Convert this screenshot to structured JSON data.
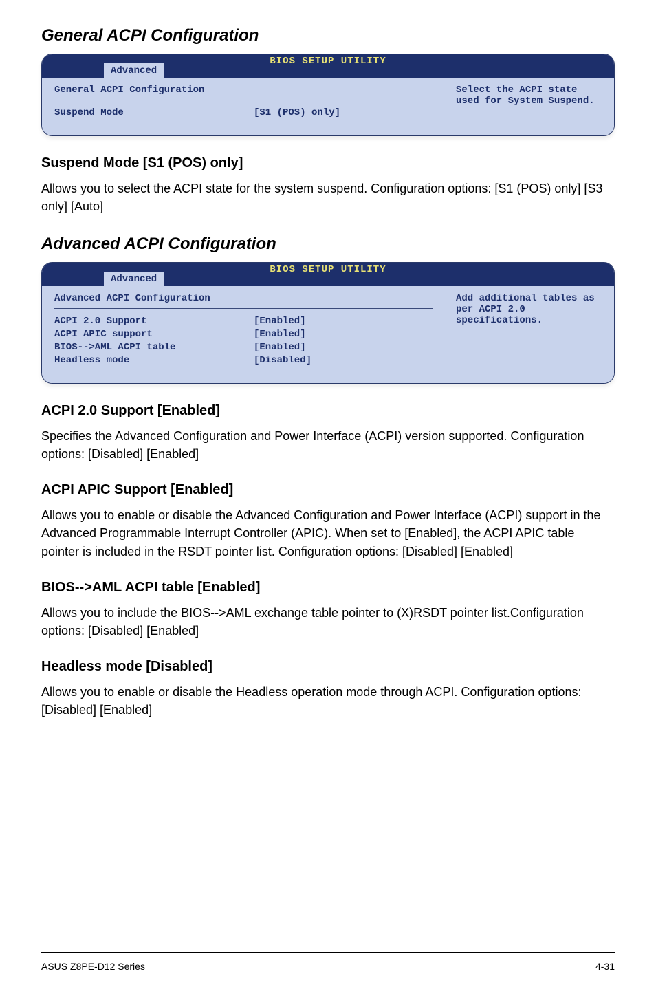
{
  "heading1": "General ACPI Configuration",
  "bios1": {
    "title": "BIOS SETUP UTILITY",
    "tab": "Advanced",
    "section": "General ACPI Configuration",
    "rows": [
      {
        "label": "Suspend Mode",
        "value": "[S1 (POS) only]"
      }
    ],
    "help": "Select the ACPI state used for System Suspend."
  },
  "sub1": "Suspend Mode [S1 (POS) only]",
  "body1": "Allows you to select the ACPI state for the system suspend. Configuration options: [S1 (POS) only] [S3 only] [Auto]",
  "heading2": "Advanced ACPI Configuration",
  "bios2": {
    "title": "BIOS SETUP UTILITY",
    "tab": "Advanced",
    "section": "Advanced ACPI Configuration",
    "rows": [
      {
        "label": "ACPI 2.0 Support",
        "value": "[Enabled]"
      },
      {
        "label": "ACPI APIC support",
        "value": "[Enabled]"
      },
      {
        "label": "BIOS-->AML ACPI table",
        "value": "[Enabled]"
      },
      {
        "label": "Headless mode",
        "value": "[Disabled]"
      }
    ],
    "help": "Add additional tables as per ACPI 2.0 specifications."
  },
  "sub2": "ACPI 2.0 Support [Enabled]",
  "body2": "Specifies the Advanced Configuration and Power Interface (ACPI) version supported. Configuration options: [Disabled] [Enabled]",
  "sub3": "ACPI APIC Support [Enabled]",
  "body3": "Allows you to enable or disable the Advanced Configuration and Power Interface (ACPI) support in the Advanced Programmable Interrupt Controller (APIC). When set to [Enabled], the ACPI APIC table pointer is included in the RSDT pointer list. Configuration options: [Disabled] [Enabled]",
  "sub4": "BIOS-->AML ACPI table [Enabled]",
  "body4": "Allows you to include the BIOS-->AML exchange table pointer to (X)RSDT pointer list.Configuration options: [Disabled] [Enabled]",
  "sub5": "Headless mode [Disabled]",
  "body5": "Allows you to enable or disable the Headless operation mode through ACPI. Configuration options: [Disabled] [Enabled]",
  "footer_left": "ASUS Z8PE-D12 Series",
  "footer_right": "4-31"
}
